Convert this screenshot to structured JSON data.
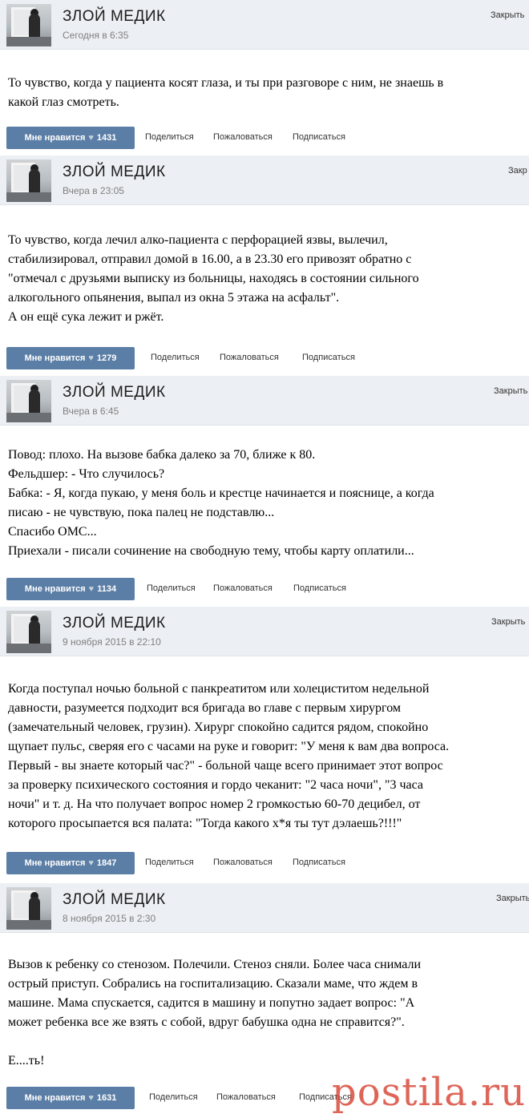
{
  "posts": [
    {
      "author": "ЗЛОЙ МЕДИК",
      "date": "Сегодня в 6:35",
      "close_label": "Закрыть",
      "lines": [
        "То чувство, когда у пациента косят глаза, и ты при разговоре с ним, не знаешь в",
        "какой глаз смотреть."
      ],
      "like_label": "Мне нравится",
      "like_count": "1431",
      "share_label": "Поделиться",
      "report_label": "Пожаловаться",
      "subscribe_label": "Подписаться"
    },
    {
      "author": "ЗЛОЙ МЕДИК",
      "date": "Вчера в 23:05",
      "close_label": "Закр",
      "lines": [
        "То чувство, когда лечил алко-пациента с перфорацией язвы, вылечил,",
        "стабилизировал, отправил домой в 16.00, а в 23.30 его привозят обратно с",
        "\"отмечал с друзьями выписку из больницы, находясь в состоянии сильного",
        "алкогольного опьянения, выпал из окна 5 этажа на асфальт\".",
        "А он ещё сука лежит и ржёт."
      ],
      "like_label": "Мне нравится",
      "like_count": "1279",
      "share_label": "Поделиться",
      "report_label": "Пожаловаться",
      "subscribe_label": "Подписаться"
    },
    {
      "author": "ЗЛОЙ МЕДИК",
      "date": "Вчера в 6:45",
      "close_label": "Закрыть",
      "lines": [
        " Повод: плохо. На вызове бабка далеко за 70, ближе к 80.",
        "Фельдшер: - Что случилось?",
        "Бабка: - Я, когда пукаю, у меня боль и крестце начинается и пояснице, а когда",
        "писаю - не чувствую, пока палец не подставлю...",
        "Спасибо ОМС...",
        "Приехали - писали сочинение на свободную тему, чтобы карту оплатили..."
      ],
      "like_label": "Мне нравится",
      "like_count": "1134",
      "share_label": "Поделиться",
      "report_label": "Пожаловаться",
      "subscribe_label": "Подписаться"
    },
    {
      "author": "ЗЛОЙ МЕДИК",
      "date": "9 ноября 2015 в 22:10",
      "close_label": "Закрыть",
      "lines": [
        "Когда поступал ночью больной с панкреатитом или холециститом недельной",
        "давности, разумеется подходит вся бригада во главе с первым хирургом",
        "(замечательный человек, грузин). Хирург спокойно садится рядом, спокойно",
        "щупает пульс, сверяя его с часами на руке и говорит: \"У меня к вам два вопроса.",
        "Первый - вы знаете который час?\" - больной чаще всего принимает этот вопрос",
        "за проверку психического состояния и гордо чеканит: \"2 часа ночи\", \"3 часа",
        "ночи\" и т. д. На что получает вопрос номер 2 громкостью 60-70 децибел, от",
        "которого просыпается вся палата: \"Тогда какого х*я ты тут дэлаешь?!!!\""
      ],
      "like_label": "Мне нравится",
      "like_count": "1847",
      "share_label": "Поделиться",
      "report_label": "Пожаловаться",
      "subscribe_label": "Подписаться"
    },
    {
      "author": "ЗЛОЙ МЕДИК",
      "date": "8 ноября 2015 в 2:30",
      "close_label": "Закрыть",
      "lines": [
        "Вызов к ребенку со стенозом. Полечили. Стеноз сняли. Более часа снимали",
        "острый приступ. Собрались на госпитализацию. Сказали маме, что ждем в",
        "машине. Мама спускается, садится в машину и попутно задает вопрос: \"А",
        "может ребенка все же взять с собой, вдруг бабушка одна не справится?\".",
        "",
        "Е....ть!"
      ],
      "like_label": "Мне нравится",
      "like_count": "1631",
      "share_label": "Поделиться",
      "report_label": "Пожаловаться",
      "subscribe_label": "Подписаться"
    }
  ],
  "watermark": "postila.ru"
}
